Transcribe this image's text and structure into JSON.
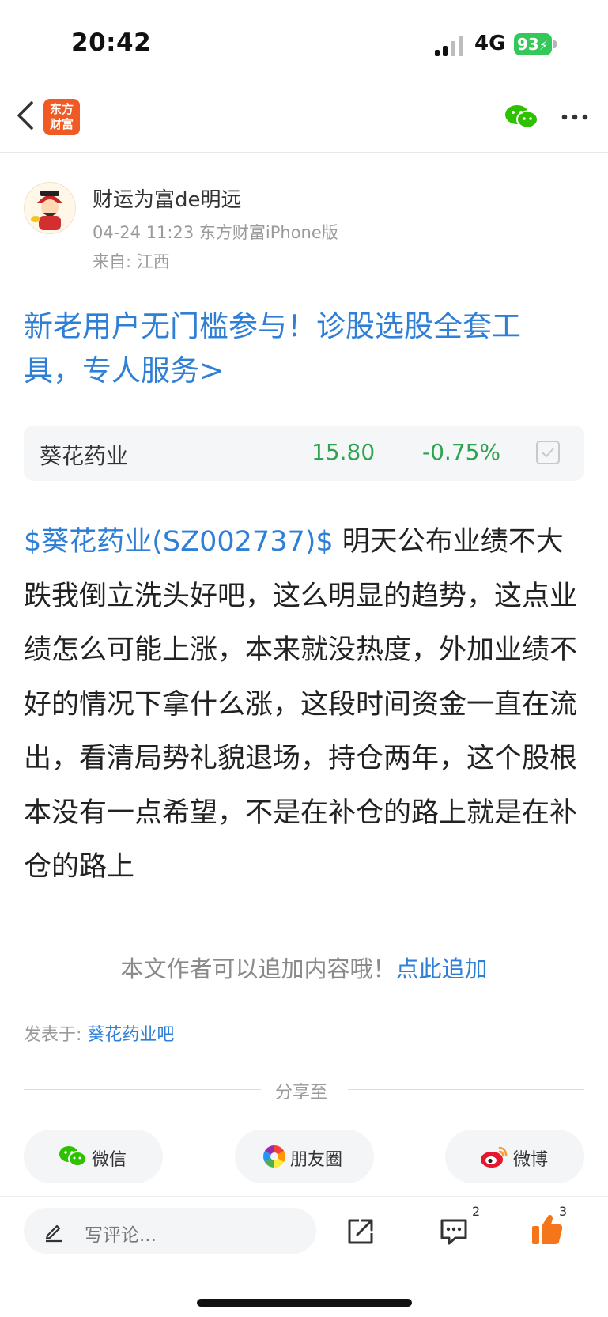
{
  "status_bar": {
    "time": "20:42",
    "network": "4G",
    "battery": "93"
  },
  "nav": {
    "logo_text": [
      "东方",
      "财富"
    ],
    "icons": [
      "back-arrow-icon",
      "wechat-icon",
      "more-icon"
    ]
  },
  "author": {
    "name": "财运为富de明远",
    "meta": "04-24 11:23  东方财富iPhone版",
    "location": "来自: 江西"
  },
  "promo": {
    "text": "新老用户无门槛参与！诊股选股全套工具，专人服务>"
  },
  "stock": {
    "name": "葵花药业",
    "price": "15.80",
    "change": "-0.75%"
  },
  "post": {
    "ticker": "$葵花药业(SZ002737)$",
    "body": "  明天公布业绩不大跌我倒立洗头好吧，这么明显的趋势，这点业绩怎么可能上涨，本来就没热度，外加业绩不好的情况下拿什么涨，这段时间资金一直在流出，看清局势礼貌退场，持仓两年，这个股根本没有一点希望，不是在补仓的路上就是在补仓的路上"
  },
  "add_content": {
    "prompt": "本文作者可以追加内容哦！",
    "link": "点此追加"
  },
  "posted_in": {
    "label": "发表于: ",
    "forum": "葵花药业吧"
  },
  "share": {
    "label": "分享至",
    "buttons": [
      {
        "label": "微信",
        "icon": "wechat-icon"
      },
      {
        "label": "朋友圈",
        "icon": "moments-icon"
      },
      {
        "label": "微博",
        "icon": "weibo-icon"
      }
    ]
  },
  "bottom_bar": {
    "comment_placeholder": "写评论...",
    "comment_count": "2",
    "like_count": "3"
  },
  "colors": {
    "link_blue": "#2f7fd7",
    "down_green": "#2ea44f",
    "brand_orange": "#f05a24",
    "like_orange": "#f5761a"
  }
}
